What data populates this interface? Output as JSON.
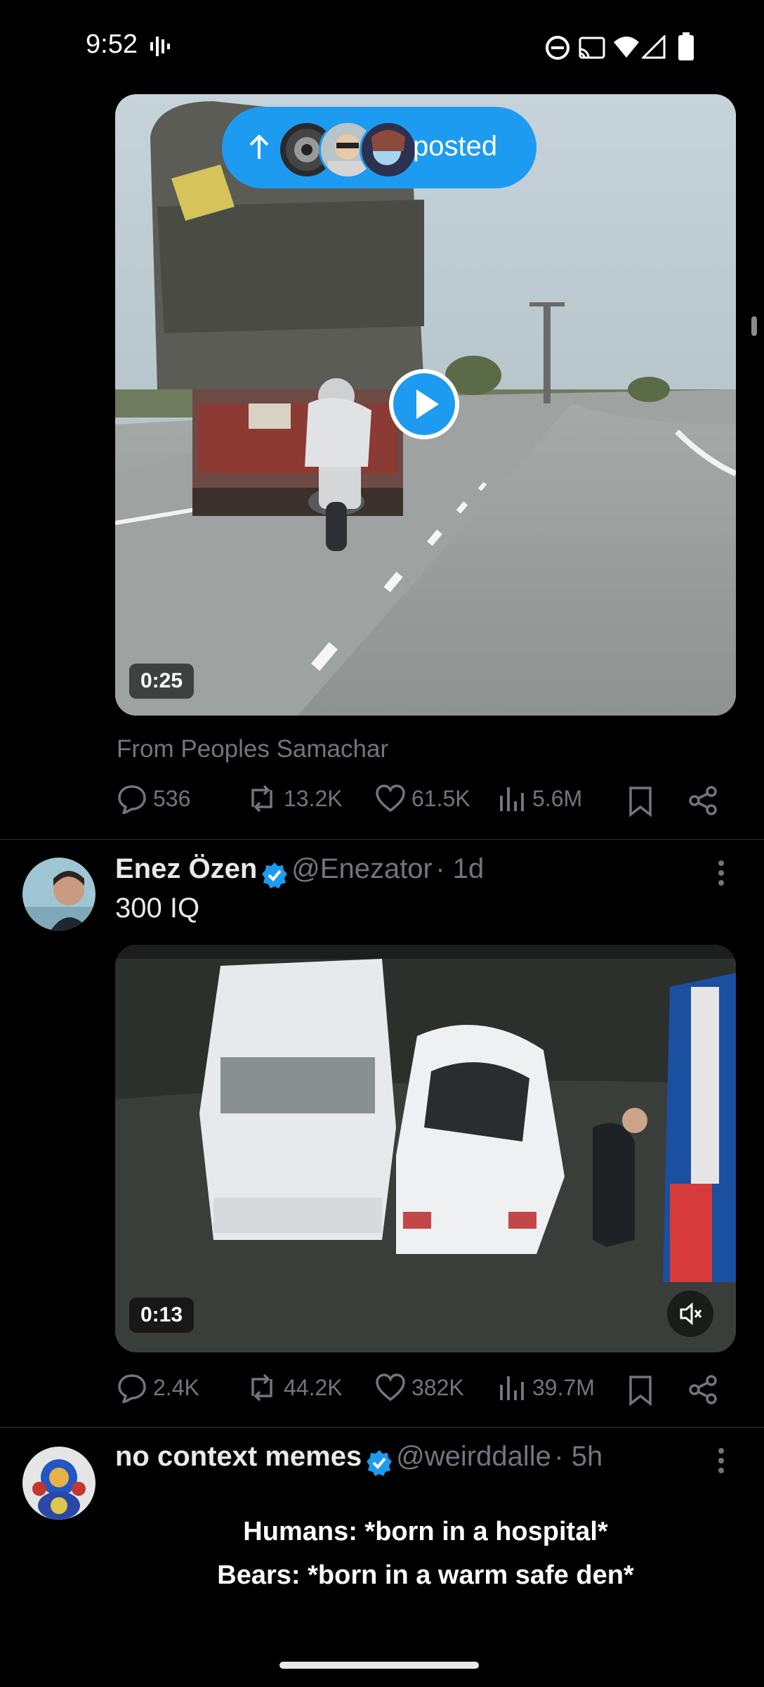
{
  "status_bar": {
    "time": "9:52"
  },
  "posted_pill": {
    "label": "posted"
  },
  "tweet1": {
    "video_duration": "0:25",
    "source": "From Peoples Samachar",
    "replies": "536",
    "reposts": "13.2K",
    "likes": "61.5K",
    "views": "5.6M"
  },
  "tweet2": {
    "name": "Enez Özen",
    "handle": "@Enezator",
    "time": "· 1d",
    "text": "300 IQ",
    "video_duration": "0:13",
    "replies": "2.4K",
    "reposts": "44.2K",
    "likes": "382K",
    "views": "39.7M"
  },
  "tweet3": {
    "name": "no context memes",
    "handle": "@weirddalle",
    "time": "· 5h",
    "line1": "Humans: *born in a hospital*",
    "line2": "Bears: *born in a warm safe den*"
  },
  "colors": {
    "accent": "#1d9bf0",
    "background": "#000000",
    "muted": "#71767b"
  }
}
